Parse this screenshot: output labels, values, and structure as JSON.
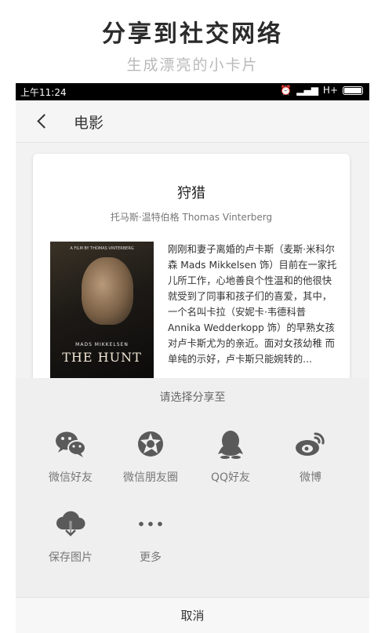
{
  "promo": {
    "title": "分享到社交网络",
    "subtitle": "生成漂亮的小卡片"
  },
  "status_bar": {
    "time": "上午11:24",
    "network": "H+"
  },
  "nav": {
    "title": "电影",
    "back_icon": "chevron-left-icon"
  },
  "card": {
    "movie_title": "狩猎",
    "director": "托马斯·温特伯格 Thomas Vinterberg",
    "poster": {
      "top_text": "A FILM BY THOMAS VINTERBERG",
      "actor": "MADS MIKKELSEN",
      "title": "THE HUNT"
    },
    "synopsis": "刚刚和妻子离婚的卢卡斯（麦斯·米科尔森 Mads Mikkelsen 饰）目前在一家托儿所工作，心地善良个性温和的他很快就受到了同事和孩子们的喜爱，其中，一个名叫卡拉（安妮卡·韦德科普 Annika Wedderkopp 饰）的早熟女孩对卢卡斯尤为的亲近。面对女孩幼稚 而单纯的示好，卢卡斯只能婉转的..."
  },
  "share_sheet": {
    "title": "请选择分享至",
    "options": [
      {
        "label": "微信好友",
        "icon": "wechat-icon"
      },
      {
        "label": "微信朋友圈",
        "icon": "wechat-moments-icon"
      },
      {
        "label": "QQ好友",
        "icon": "qq-icon"
      },
      {
        "label": "微博",
        "icon": "weibo-icon"
      },
      {
        "label": "保存图片",
        "icon": "cloud-download-icon"
      },
      {
        "label": "更多",
        "icon": "more-icon"
      }
    ],
    "cancel": "取消"
  }
}
